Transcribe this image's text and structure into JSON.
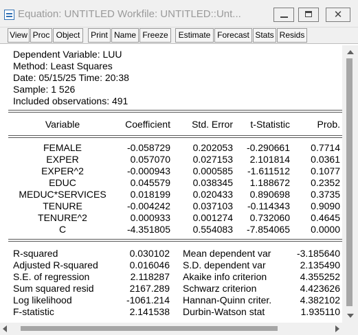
{
  "window": {
    "title": "Equation: UNTITLED   Workfile: UNTITLED::Unt...",
    "minimize_icon": "minimize-icon",
    "maximize_icon": "maximize-icon",
    "close_glyph": "✕"
  },
  "toolbar": {
    "buttons": [
      "View",
      "Proc",
      "Object",
      "Print",
      "Name",
      "Freeze",
      "Estimate",
      "Forecast",
      "Stats",
      "Resids"
    ]
  },
  "header": {
    "dependent": "Dependent Variable: LUU",
    "method": "Method: Least Squares",
    "date": "Date: 05/15/25   Time: 20:38",
    "sample": "Sample: 1 526",
    "included": "Included observations: 491"
  },
  "table": {
    "columns": [
      "Variable",
      "Coefficient",
      "Std. Error",
      "t-Statistic",
      "Prob."
    ],
    "rows": [
      {
        "variable": "FEMALE",
        "coefficient": "-0.058729",
        "std_error": "0.202053",
        "t_stat": "-0.290661",
        "prob": "0.7714"
      },
      {
        "variable": "EXPER",
        "coefficient": "0.057070",
        "std_error": "0.027153",
        "t_stat": "2.101814",
        "prob": "0.0361"
      },
      {
        "variable": "EXPER^2",
        "coefficient": "-0.000943",
        "std_error": "0.000585",
        "t_stat": "-1.611512",
        "prob": "0.1077"
      },
      {
        "variable": "EDUC",
        "coefficient": "0.045579",
        "std_error": "0.038345",
        "t_stat": "1.188672",
        "prob": "0.2352"
      },
      {
        "variable": "MEDUC*SERVICES",
        "coefficient": "0.018199",
        "std_error": "0.020433",
        "t_stat": "0.890698",
        "prob": "0.3735"
      },
      {
        "variable": "TENURE",
        "coefficient": "-0.004242",
        "std_error": "0.037103",
        "t_stat": "-0.114343",
        "prob": "0.9090"
      },
      {
        "variable": "TENURE^2",
        "coefficient": "0.000933",
        "std_error": "0.001274",
        "t_stat": "0.732060",
        "prob": "0.4645"
      },
      {
        "variable": "C",
        "coefficient": "-4.351805",
        "std_error": "0.554083",
        "t_stat": "-7.854065",
        "prob": "0.0000"
      }
    ]
  },
  "stats": {
    "left": [
      {
        "label": "R-squared",
        "value": "0.030102"
      },
      {
        "label": "Adjusted R-squared",
        "value": "0.016046"
      },
      {
        "label": "S.E. of regression",
        "value": "2.118287"
      },
      {
        "label": "Sum squared resid",
        "value": "2167.289"
      },
      {
        "label": "Log likelihood",
        "value": "-1061.214"
      },
      {
        "label": "F-statistic",
        "value": "2.141538"
      }
    ],
    "right": [
      {
        "label": "Mean dependent var",
        "value": "-3.185640"
      },
      {
        "label": "S.D. dependent var",
        "value": "2.135490"
      },
      {
        "label": "Akaike info criterion",
        "value": "4.355252"
      },
      {
        "label": "Schwarz criterion",
        "value": "4.423626"
      },
      {
        "label": "Hannan-Quinn criter.",
        "value": "4.382102"
      },
      {
        "label": "Durbin-Watson stat",
        "value": "1.935110"
      }
    ]
  }
}
